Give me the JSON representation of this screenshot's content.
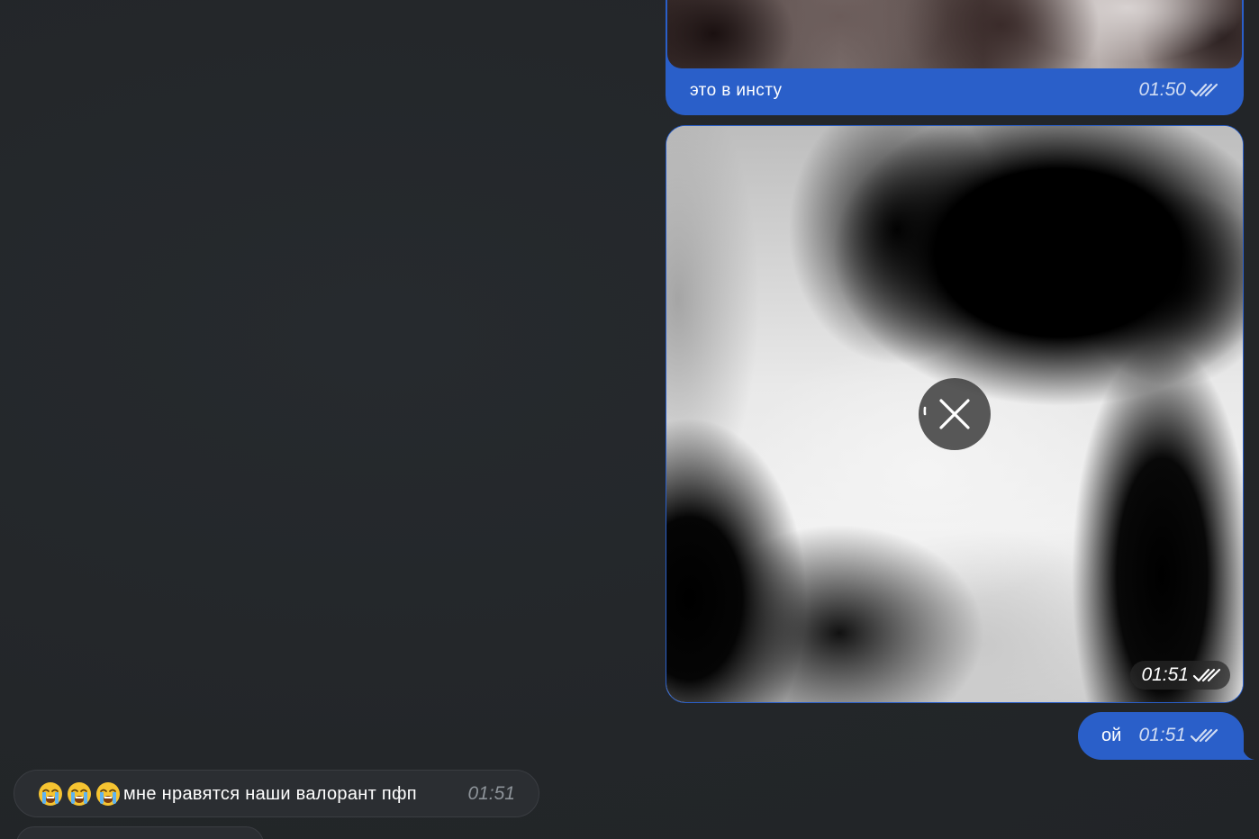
{
  "messages": {
    "photo_caption": {
      "caption": "это в инсту",
      "time": "01:50",
      "status": "read"
    },
    "photo_large": {
      "time": "01:51",
      "status": "read",
      "overlay_icon": "cancel-download-icon"
    },
    "short_reply": {
      "text": "ой",
      "time": "01:51",
      "status": "read"
    },
    "incoming": {
      "emoji": [
        "loudly-crying-face",
        "loudly-crying-face",
        "loudly-crying-face"
      ],
      "text": "мне нравятся наши валорант пфп",
      "time": "01:51"
    }
  },
  "colors": {
    "background": "#232629",
    "outgoing_bubble": "#2a5fc9",
    "incoming_bubble": "#2b2e32",
    "timestamp_incoming": "#8d9399"
  }
}
